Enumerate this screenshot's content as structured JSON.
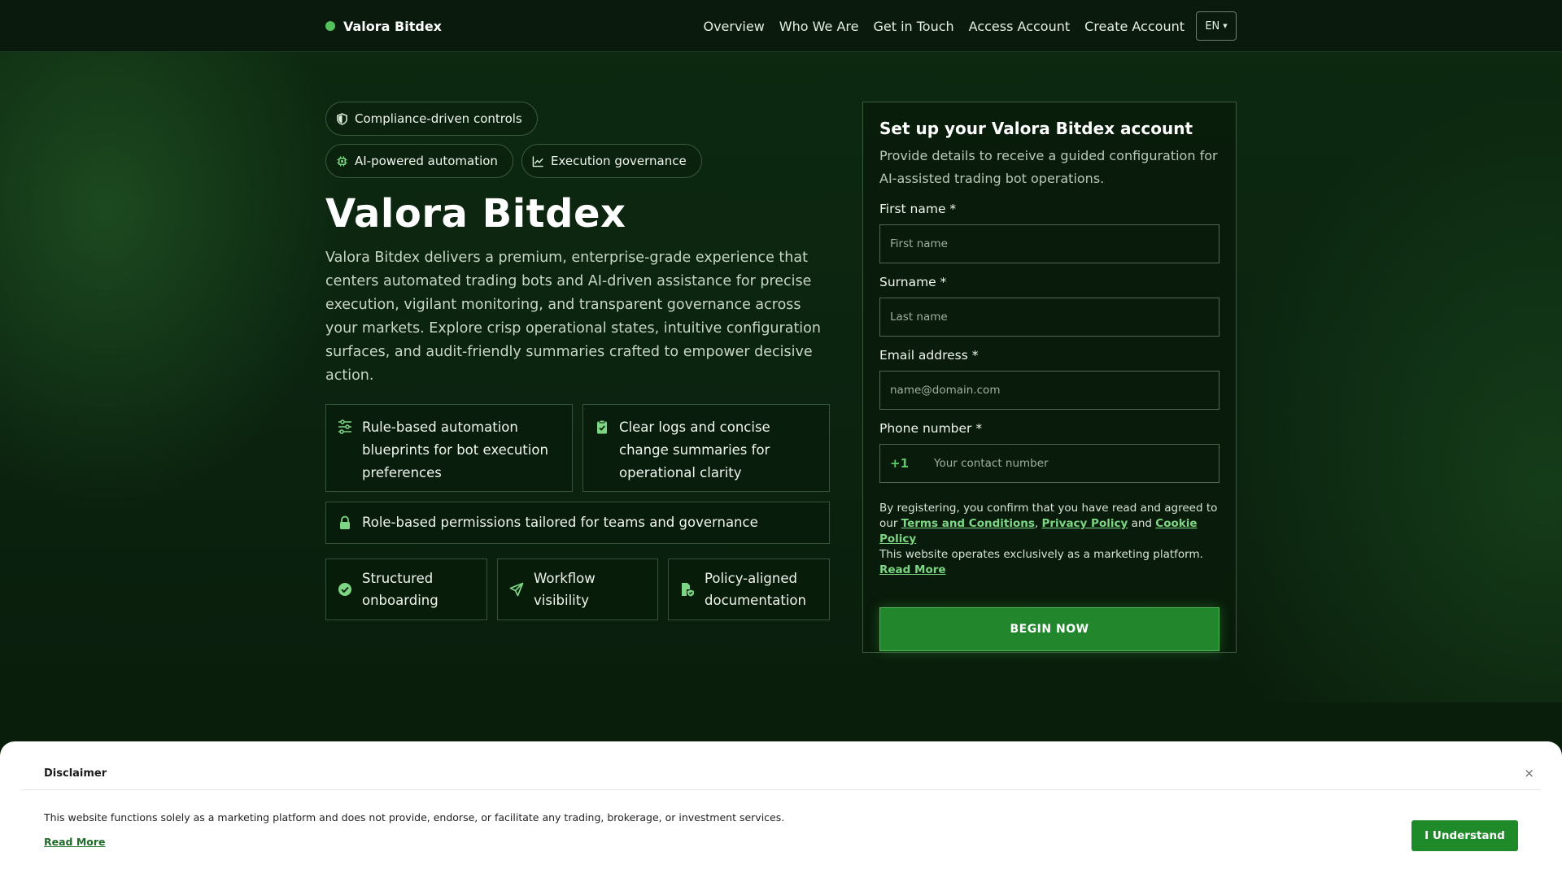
{
  "header": {
    "brand": "Valora Bitdex",
    "nav": [
      "Overview",
      "Who We Are",
      "Get in Touch",
      "Access Account",
      "Create Account"
    ],
    "lang": "EN"
  },
  "hero": {
    "chips": [
      "Compliance-driven controls",
      "AI-powered automation",
      "Execution governance"
    ],
    "title": "Valora Bitdex",
    "description": "Valora Bitdex delivers a premium, enterprise-grade experience that centers automated trading bots and AI-driven assistance for precise execution, vigilant monitoring, and transparent governance across your markets. Explore crisp operational states, intuitive configuration surfaces, and audit-friendly summaries crafted to empower decisive action.",
    "features": [
      "Rule-based automation blueprints for bot execution preferences",
      "Clear logs and concise change summaries for operational clarity",
      "Role-based permissions tailored for teams and governance"
    ],
    "mini": [
      "Structured onboarding",
      "Workflow visibility",
      "Policy-aligned documentation"
    ]
  },
  "form": {
    "title": "Set up your Valora Bitdex account",
    "subtitle": "Provide details to receive a guided configuration for AI-assisted trading bot operations.",
    "first_label": "First name *",
    "first_placeholder": "First name",
    "surname_label": "Surname *",
    "surname_placeholder": "Last name",
    "email_label": "Email address *",
    "email_placeholder": "name@domain.com",
    "phone_label": "Phone number *",
    "phone_code": "+1",
    "phone_placeholder": "Your contact number",
    "legal_prefix": "By registering, you confirm that you have read and agreed to our",
    "terms": "Terms and Conditions",
    "comma": ",",
    "privacy": "Privacy Policy",
    "and": "and",
    "cookie": "Cookie Policy",
    "legal_note": "This website operates exclusively as a marketing platform.",
    "read_more": "Read More",
    "cta": "BEGIN NOW"
  },
  "disclaimer": {
    "title": "Disclaimer",
    "close": "×",
    "text": "This website functions solely as a marketing platform and does not provide, endorse, or facilitate any trading, brokerage, or investment services.",
    "read_more": "Read More",
    "button": "I Understand"
  },
  "colors": {
    "accent": "#22872c",
    "accent_light": "#52c35a",
    "link": "#7cd684",
    "bg": "#0a1a0c"
  },
  "icons": [
    "shield-icon",
    "chip-icon",
    "chart-line-icon",
    "sliders-icon",
    "clipboard-check-icon",
    "lock-icon",
    "check-circle-icon",
    "send-icon",
    "file-shield-icon",
    "close-icon"
  ]
}
